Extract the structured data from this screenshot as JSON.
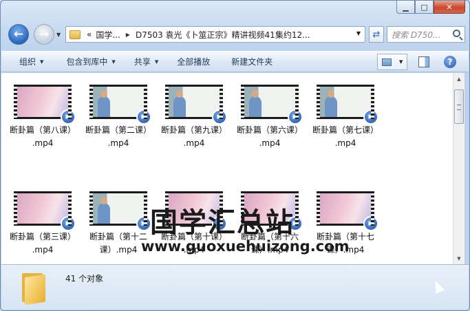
{
  "window": {
    "caption": {
      "min": "▁",
      "max": "□",
      "close": "✕"
    }
  },
  "nav": {
    "history_glyph": "▼",
    "breadcrumbs": [
      "«",
      "国学...",
      "D7503 袁光《卜筮正宗》精讲视频41集约12..."
    ],
    "sep_glyph": "▶",
    "dropdown_glyph": "▼",
    "refresh_glyph": "⇄",
    "search_placeholder": "搜索 D750..."
  },
  "toolbar": {
    "items": [
      {
        "label": "组织",
        "has_menu": true
      },
      {
        "label": "包含到库中",
        "has_menu": true
      },
      {
        "label": "共享",
        "has_menu": true
      },
      {
        "label": "全部播放",
        "has_menu": false
      },
      {
        "label": "新建文件夹",
        "has_menu": false
      }
    ],
    "menu_glyph": "▼",
    "help_glyph": "?"
  },
  "files": [
    {
      "line1": "断卦篇（第八课）",
      "line2": ".mp4",
      "thumb": "pink"
    },
    {
      "line1": "断卦篇（第二课）",
      "line2": ".mp4",
      "thumb": "lecture"
    },
    {
      "line1": "断卦篇（第九课）",
      "line2": ".mp4",
      "thumb": "lecture"
    },
    {
      "line1": "断卦篇（第六课）",
      "line2": ".mp4",
      "thumb": "lecture"
    },
    {
      "line1": "断卦篇（第七课）",
      "line2": ".mp4",
      "thumb": "lecture"
    },
    {
      "line1": "断卦篇（第三课）",
      "line2": ".mp4",
      "thumb": "pink"
    },
    {
      "line1": "断卦篇（第十二",
      "line2": "课）.mp4",
      "thumb": "lecture"
    },
    {
      "line1": "断卦篇（第十课）",
      "line2": ".mp4",
      "thumb": "pink"
    },
    {
      "line1": "断卦篇（第十六",
      "line2": "课）.mp4",
      "thumb": "pink"
    },
    {
      "line1": "断卦篇（第十七",
      "line2": "课）.mp4",
      "thumb": "pink"
    }
  ],
  "watermark": {
    "title": "国学汇总站",
    "url": "www.guoxuehuizong.com"
  },
  "status": {
    "count": "41 个对象"
  },
  "scrollbar": {
    "up": "▲",
    "down": "▼"
  }
}
